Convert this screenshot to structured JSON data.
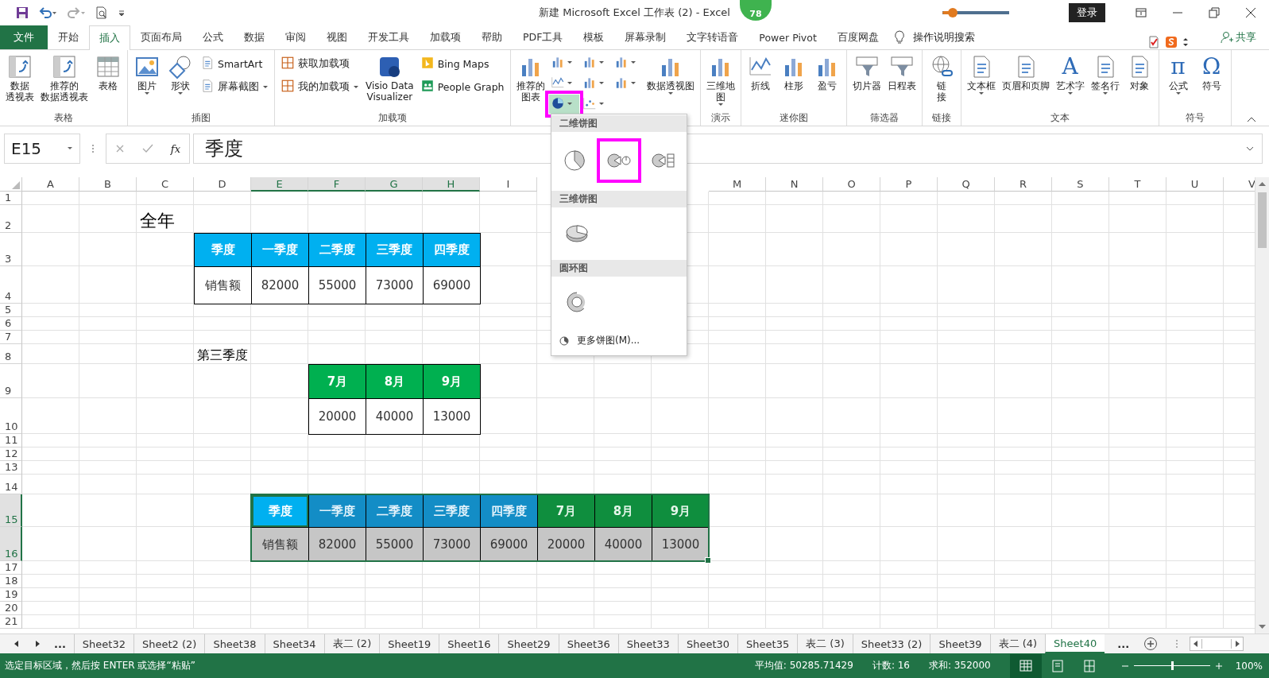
{
  "title_bar": {
    "title": "新建 Microsoft Excel 工作表 (2)  -  Excel",
    "badge": "78",
    "slider": {
      "level": 0.15
    },
    "login": "登录"
  },
  "ribbon_tabs": [
    {
      "label": "文件",
      "kind": "file",
      "selected": false
    },
    {
      "label": "开始",
      "kind": "tab",
      "selected": false
    },
    {
      "label": "插入",
      "kind": "tab",
      "selected": true
    },
    {
      "label": "页面布局",
      "kind": "tab",
      "selected": false
    },
    {
      "label": "公式",
      "kind": "tab",
      "selected": false
    },
    {
      "label": "数据",
      "kind": "tab",
      "selected": false
    },
    {
      "label": "审阅",
      "kind": "tab",
      "selected": false
    },
    {
      "label": "视图",
      "kind": "tab",
      "selected": false
    },
    {
      "label": "开发工具",
      "kind": "tab",
      "selected": false
    },
    {
      "label": "加载项",
      "kind": "tab",
      "selected": false
    },
    {
      "label": "帮助",
      "kind": "tab",
      "selected": false
    },
    {
      "label": "PDF工具",
      "kind": "tab",
      "selected": false
    },
    {
      "label": "模板",
      "kind": "tab",
      "selected": false
    },
    {
      "label": "屏幕录制",
      "kind": "tab",
      "selected": false
    },
    {
      "label": "文字转语音",
      "kind": "tab",
      "selected": false
    },
    {
      "label": "Power Pivot",
      "kind": "tab",
      "selected": false
    },
    {
      "label": "百度网盘",
      "kind": "tab",
      "selected": false
    }
  ],
  "tell_me": "操作说明搜索",
  "share": "共享",
  "ribbon_groups": [
    {
      "label": "表格",
      "items": [
        {
          "kind": "large",
          "lines": [
            "数据",
            "透视表"
          ],
          "menu": false
        },
        {
          "kind": "large",
          "lines": [
            "推荐的",
            "数据透视表"
          ],
          "menu": false
        },
        {
          "kind": "large",
          "lines": [
            "表格"
          ],
          "menu": false
        }
      ]
    },
    {
      "label": "插图",
      "items": [
        {
          "kind": "large",
          "lines": [
            "图片"
          ],
          "menu": true
        },
        {
          "kind": "large",
          "lines": [
            "形状"
          ],
          "menu": true
        },
        {
          "kind": "stack",
          "items": [
            {
              "label": "SmartArt",
              "menu": false
            },
            {
              "label": "屏幕截图",
              "menu": true
            }
          ]
        }
      ]
    },
    {
      "label": "加载项",
      "items": [
        {
          "kind": "stack",
          "items": [
            {
              "label": "获取加载项",
              "menu": false
            },
            {
              "label": "我的加载项",
              "menu": true
            }
          ]
        },
        {
          "kind": "large",
          "lines": [
            "Visio Data",
            "Visualizer"
          ],
          "menu": false
        },
        {
          "kind": "stack",
          "items": [
            {
              "label": "Bing Maps",
              "menu": false
            },
            {
              "label": "People Graph",
              "menu": false
            }
          ]
        }
      ]
    },
    {
      "items": [
        {
          "kind": "large",
          "lines": [
            "推荐的",
            "图表"
          ],
          "menu": false
        },
        {
          "kind": "charts",
          "buttons": [
            {
              "highlighted": false
            },
            {
              "highlighted": false
            },
            {
              "highlighted": false
            },
            {
              "highlighted": false
            },
            {
              "highlighted": false
            },
            {
              "highlighted": false
            },
            {
              "highlighted": true
            },
            {
              "highlighted": false
            }
          ]
        },
        {
          "kind": "large",
          "lines": [
            "数据透视图"
          ],
          "menu": true
        }
      ]
    },
    {
      "label": "演示",
      "items": [
        {
          "kind": "large",
          "lines": [
            "三维地",
            "图"
          ],
          "menu": true
        }
      ]
    },
    {
      "label": "迷你图",
      "items": [
        {
          "kind": "large",
          "lines": [
            "折线"
          ],
          "menu": false
        },
        {
          "kind": "large",
          "lines": [
            "柱形"
          ],
          "menu": false
        },
        {
          "kind": "large",
          "lines": [
            "盈亏"
          ],
          "menu": false
        }
      ]
    },
    {
      "label": "筛选器",
      "items": [
        {
          "kind": "large",
          "lines": [
            "切片器"
          ],
          "menu": false
        },
        {
          "kind": "large",
          "lines": [
            "日程表"
          ],
          "menu": false
        }
      ]
    },
    {
      "label": "链接",
      "items": [
        {
          "kind": "large",
          "lines": [
            "链",
            "接"
          ],
          "menu": false
        }
      ]
    },
    {
      "label": "文本",
      "items": [
        {
          "kind": "large",
          "lines": [
            "文本框"
          ],
          "menu": true
        },
        {
          "kind": "large",
          "lines": [
            "页眉和页脚"
          ],
          "menu": false
        },
        {
          "kind": "large",
          "lines": [
            "艺术字"
          ],
          "menu": true,
          "glyph": "A"
        },
        {
          "kind": "large",
          "lines": [
            "签名行"
          ],
          "menu": true
        },
        {
          "kind": "large",
          "lines": [
            "对象"
          ],
          "menu": false
        }
      ]
    },
    {
      "label": "符号",
      "items": [
        {
          "kind": "large",
          "lines": [
            "公式"
          ],
          "menu": true,
          "glyph": "π"
        },
        {
          "kind": "large",
          "lines": [
            "符号"
          ],
          "menu": false,
          "glyph": "Ω"
        }
      ]
    }
  ],
  "formula_bar": {
    "name_box": "E15",
    "fx": "fx",
    "value": "季度"
  },
  "sheet": {
    "columns": [
      {
        "label": "A",
        "selected": false
      },
      {
        "label": "B",
        "selected": false
      },
      {
        "label": "C",
        "selected": false
      },
      {
        "label": "D",
        "selected": false
      },
      {
        "label": "E",
        "selected": true
      },
      {
        "label": "F",
        "selected": true
      },
      {
        "label": "G",
        "selected": true
      },
      {
        "label": "H",
        "selected": true
      },
      {
        "label": "I",
        "selected": false
      },
      {},
      {},
      {},
      {
        "label": "M",
        "selected": false
      },
      {
        "label": "N",
        "selected": false
      },
      {
        "label": "O",
        "selected": false
      },
      {
        "label": "P",
        "selected": false
      },
      {
        "label": "Q",
        "selected": false
      },
      {
        "label": "R",
        "selected": false
      },
      {
        "label": "S",
        "selected": false
      },
      {
        "label": "T",
        "selected": false
      },
      {
        "label": "U",
        "selected": false
      },
      {
        "label": "V",
        "selected": false
      }
    ],
    "rows": [
      {
        "number": "1",
        "selected": false
      },
      {
        "number": "2",
        "selected": false,
        "cells": [
          {},
          {},
          {
            "text": "全年",
            "kind": "title",
            "selected": false,
            "active": false
          }
        ]
      },
      {
        "number": "3",
        "selected": false,
        "cells": [
          {},
          {},
          {},
          {
            "text": "季度",
            "kind": "blue-header",
            "selected": false,
            "active": false
          },
          {
            "text": "一季度",
            "kind": "blue-header",
            "selected": false,
            "active": false
          },
          {
            "text": "二季度",
            "kind": "blue-header",
            "selected": false,
            "active": false
          },
          {
            "text": "三季度",
            "kind": "blue-header",
            "selected": false,
            "active": false
          },
          {
            "text": "四季度",
            "kind": "blue-header",
            "selected": false,
            "active": false
          }
        ]
      },
      {
        "number": "4",
        "selected": false,
        "cells": [
          {},
          {},
          {},
          {
            "text": "销售额",
            "kind": "data",
            "selected": false,
            "active": false
          },
          {
            "text": "82000",
            "kind": "data",
            "selected": false,
            "active": false
          },
          {
            "text": "55000",
            "kind": "data",
            "selected": false,
            "active": false
          },
          {
            "text": "73000",
            "kind": "data",
            "selected": false,
            "active": false
          },
          {
            "text": "69000",
            "kind": "data",
            "selected": false,
            "active": false
          }
        ]
      },
      {
        "number": "5",
        "selected": false
      },
      {
        "number": "6",
        "selected": false
      },
      {
        "number": "7",
        "selected": false
      },
      {
        "number": "8",
        "selected": false,
        "cells": [
          {},
          {},
          {},
          {
            "text": "第三季度",
            "kind": "label",
            "selected": false,
            "active": false
          }
        ]
      },
      {
        "number": "9",
        "selected": false,
        "cells": [
          {},
          {},
          {},
          {},
          {},
          {
            "text": "7月",
            "kind": "green-header",
            "selected": false,
            "active": false
          },
          {
            "text": "8月",
            "kind": "green-header",
            "selected": false,
            "active": false
          },
          {
            "text": "9月",
            "kind": "green-header",
            "selected": false,
            "active": false
          }
        ]
      },
      {
        "number": "10",
        "selected": false,
        "cells": [
          {},
          {},
          {},
          {},
          {},
          {
            "text": "20000",
            "kind": "data",
            "selected": false,
            "active": false
          },
          {
            "text": "40000",
            "kind": "data",
            "selected": false,
            "active": false
          },
          {
            "text": "13000",
            "kind": "data",
            "selected": false,
            "active": false
          }
        ]
      },
      {
        "number": "11",
        "selected": false
      },
      {
        "number": "12",
        "selected": false
      },
      {
        "number": "13",
        "selected": false
      },
      {
        "number": "14",
        "selected": false
      },
      {
        "number": "15",
        "selected": true,
        "cells": [
          {},
          {},
          {},
          {},
          {
            "text": "季度",
            "kind": "blue-header",
            "selected": true,
            "active": true
          },
          {
            "text": "一季度",
            "kind": "blue-header",
            "selected": true,
            "active": false
          },
          {
            "text": "二季度",
            "kind": "blue-header",
            "selected": true,
            "active": false
          },
          {
            "text": "三季度",
            "kind": "blue-header",
            "selected": true,
            "active": false
          },
          {
            "text": "四季度",
            "kind": "blue-header",
            "selected": true,
            "active": false
          },
          {
            "text": "7月",
            "kind": "green-header",
            "selected": true,
            "active": false
          },
          {
            "text": "8月",
            "kind": "green-header",
            "selected": true,
            "active": false
          },
          {
            "text": "9月",
            "kind": "green-header",
            "selected": true,
            "active": false
          }
        ]
      },
      {
        "number": "16",
        "selected": true,
        "cells": [
          {},
          {},
          {},
          {},
          {
            "text": "销售额",
            "kind": "data",
            "selected": true,
            "active": false
          },
          {
            "text": "82000",
            "kind": "data",
            "selected": true,
            "active": false
          },
          {
            "text": "55000",
            "kind": "data",
            "selected": true,
            "active": false
          },
          {
            "text": "73000",
            "kind": "data",
            "selected": true,
            "active": false
          },
          {
            "text": "69000",
            "kind": "data",
            "selected": true,
            "active": false
          },
          {
            "text": "20000",
            "kind": "data",
            "selected": true,
            "active": false
          },
          {
            "text": "40000",
            "kind": "data",
            "selected": true,
            "active": false
          },
          {
            "text": "13000",
            "kind": "data",
            "selected": true,
            "active": false
          }
        ]
      },
      {
        "number": "17",
        "selected": false
      },
      {
        "number": "18",
        "selected": false
      },
      {
        "number": "19",
        "selected": false
      },
      {
        "number": "20",
        "selected": false
      },
      {
        "number": "21",
        "selected": false
      }
    ]
  },
  "pie_menu": {
    "sections": [
      {
        "title": "二维饼图",
        "options": [
          {
            "highlighted": false
          },
          {
            "highlighted": true
          },
          {
            "highlighted": false
          }
        ]
      },
      {
        "title": "三维饼图",
        "options": [
          {
            "highlighted": false
          }
        ]
      },
      {
        "title": "圆环图",
        "options": [
          {
            "highlighted": false
          }
        ]
      }
    ],
    "more": "更多饼图(M)..."
  },
  "sheet_tabs": {
    "overflow_left": "...",
    "overflow_right": "...",
    "tabs": [
      {
        "label": "Sheet32",
        "selected": false
      },
      {
        "label": "Sheet2 (2)",
        "selected": false
      },
      {
        "label": "Sheet38",
        "selected": false
      },
      {
        "label": "Sheet34",
        "selected": false
      },
      {
        "label": "表二 (2)",
        "selected": false
      },
      {
        "label": "Sheet19",
        "selected": false
      },
      {
        "label": "Sheet16",
        "selected": false
      },
      {
        "label": "Sheet29",
        "selected": false
      },
      {
        "label": "Sheet36",
        "selected": false
      },
      {
        "label": "Sheet33",
        "selected": false
      },
      {
        "label": "Sheet30",
        "selected": false
      },
      {
        "label": "Sheet35",
        "selected": false
      },
      {
        "label": "表二 (3)",
        "selected": false
      },
      {
        "label": "Sheet33 (2)",
        "selected": false
      },
      {
        "label": "Sheet39",
        "selected": false
      },
      {
        "label": "表二 (4)",
        "selected": false
      },
      {
        "label": "Sheet40",
        "selected": true
      }
    ]
  },
  "status_bar": {
    "message": "选定目标区域，然后按 ENTER 或选择“粘贴”",
    "stats": [
      "平均值: 50285.71429",
      "计数: 16",
      "求和: 352000"
    ],
    "zoom": {
      "level": 0.5,
      "reading": "100%"
    }
  }
}
